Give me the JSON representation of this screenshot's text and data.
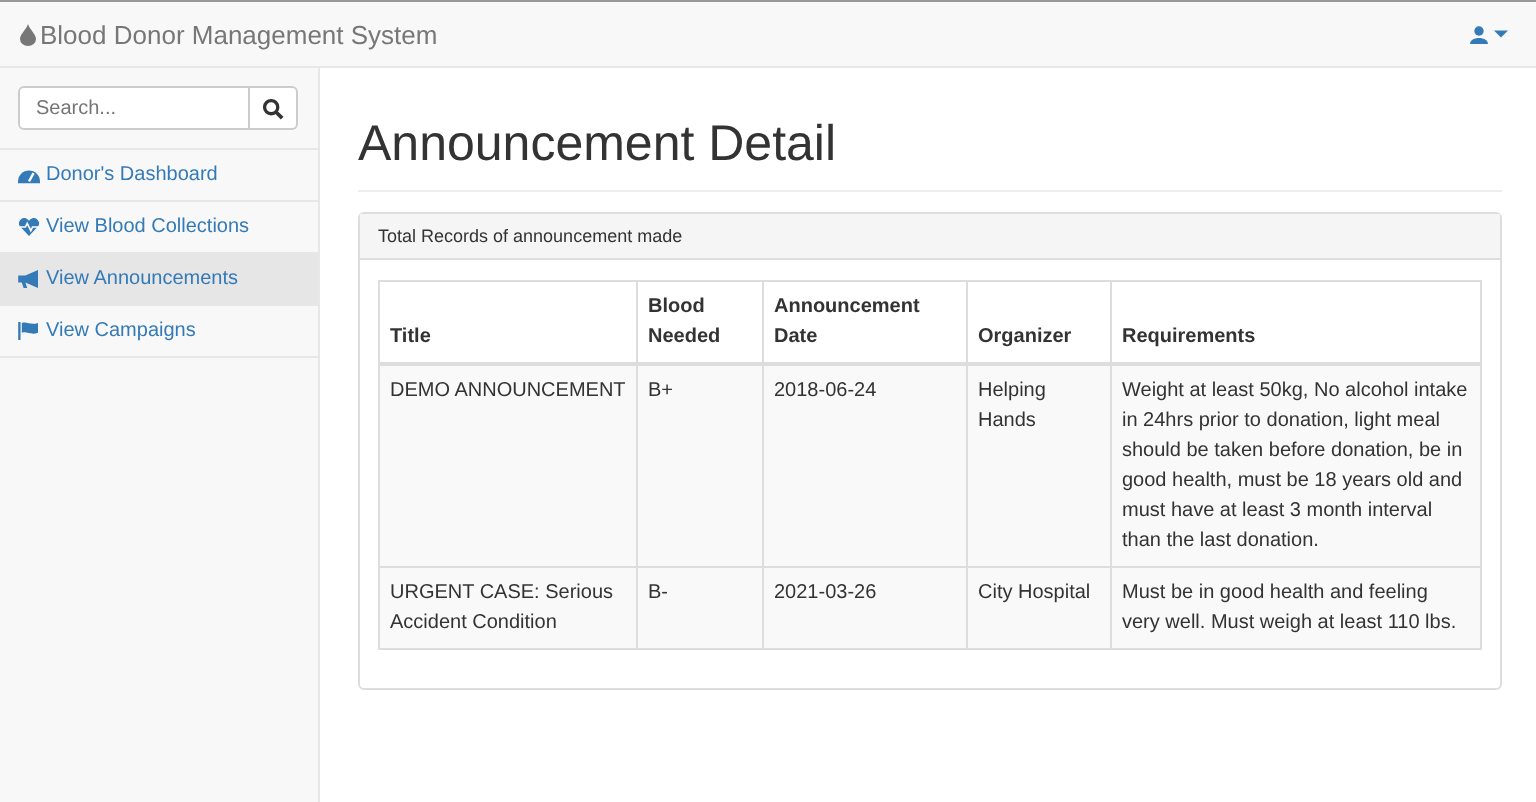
{
  "navbar": {
    "brand": "Blood Donor Management System"
  },
  "sidebar": {
    "search": {
      "placeholder": "Search..."
    },
    "items": [
      {
        "label": "Donor's Dashboard",
        "kind": "dashboard",
        "selected": false
      },
      {
        "label": "View Blood Collections",
        "kind": "heart",
        "selected": false
      },
      {
        "label": "View Announcements",
        "kind": "bullhorn",
        "selected": true
      },
      {
        "label": "View Campaigns",
        "kind": "flag",
        "selected": false
      }
    ]
  },
  "page": {
    "title": "Announcement Detail",
    "panel_heading": "Total Records of announcement made"
  },
  "table": {
    "columns": [
      "Title",
      "Blood Needed",
      "Announcement Date",
      "Organizer",
      "Requirements"
    ],
    "rows": [
      [
        "DEMO ANNOUNCEMENT",
        "B+",
        "2018-06-24",
        "Helping Hands",
        "Weight at least 50kg, No alcohol intake in 24hrs prior to donation, light meal should be taken before donation, be in good health, must be 18 years old and must have at least 3 month interval than the last donation."
      ],
      [
        "URGENT CASE: Serious Accident Condition",
        "B-",
        "2021-03-26",
        "City Hospital",
        "Must be in good health and feeling very well. Must weigh at least 110 lbs."
      ]
    ]
  }
}
